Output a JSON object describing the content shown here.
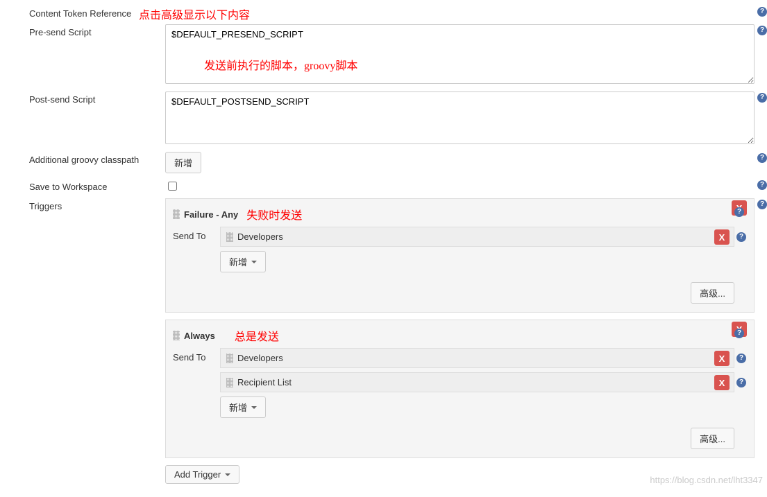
{
  "rows": {
    "content_token_ref": "Content Token Reference",
    "presend": "Pre-send Script",
    "postsend": "Post-send Script",
    "classpath": "Additional groovy classpath",
    "save_workspace": "Save to Workspace",
    "triggers": "Triggers"
  },
  "fields": {
    "presend_value": "$DEFAULT_PRESEND_SCRIPT",
    "postsend_value": "$DEFAULT_POSTSEND_SCRIPT"
  },
  "buttons": {
    "add": "新增",
    "advanced": "高级...",
    "add_trigger": "Add Trigger",
    "x": "X"
  },
  "triggers_list": [
    {
      "title": "Failure - Any",
      "annot": "失败时发送",
      "sendto_label": "Send To",
      "recipients": [
        "Developers"
      ]
    },
    {
      "title": "Always",
      "annot": "总是发送",
      "sendto_label": "Send To",
      "recipients": [
        "Developers",
        "Recipient List"
      ]
    }
  ],
  "annotations": {
    "top": "点击高级显示以下内容",
    "presend_note": "发送前执行的脚本，groovy脚本"
  },
  "help_glyph": "?",
  "watermark": "https://blog.csdn.net/lht3347"
}
